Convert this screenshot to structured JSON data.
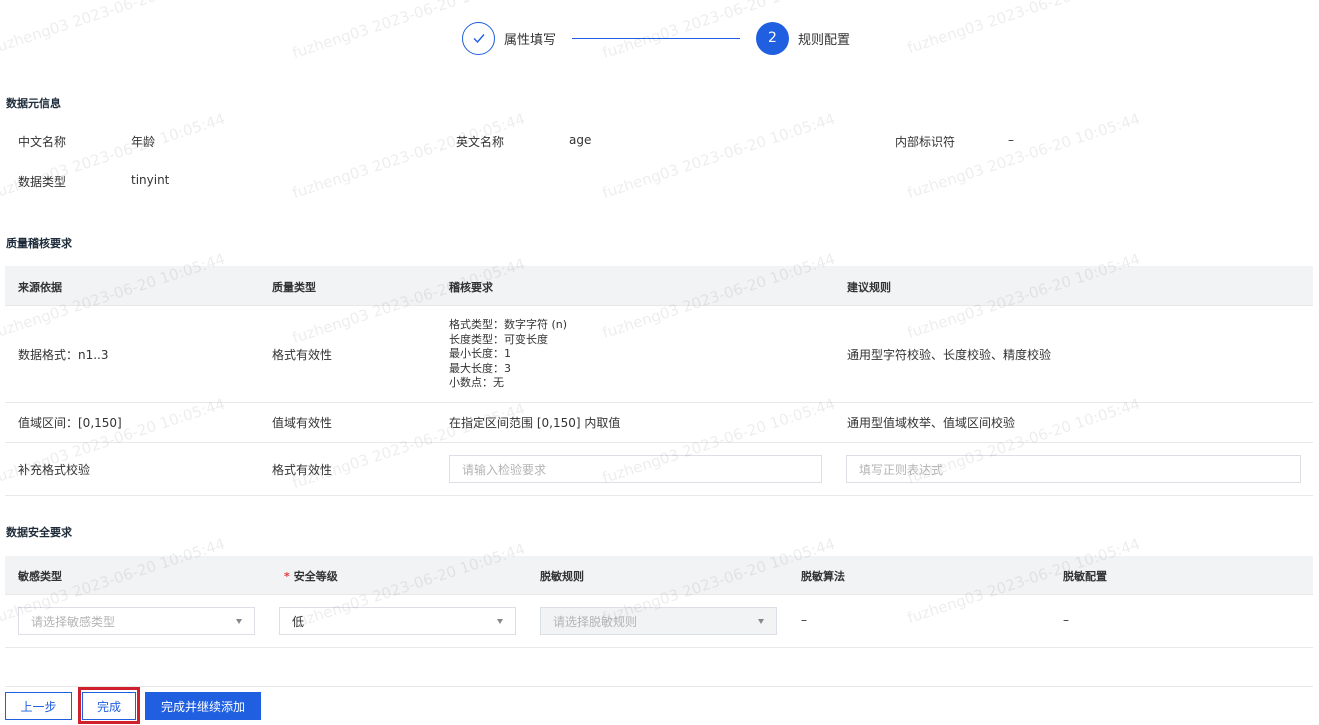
{
  "steps": [
    {
      "label": "属性填写",
      "state": "done",
      "icon": "check-icon"
    },
    {
      "label": "规则配置",
      "state": "active",
      "number": "2"
    }
  ],
  "watermark": "fuzheng03 2023-06-20 10:05:44",
  "metadata": {
    "title": "数据元信息",
    "fields": {
      "cn_name_label": "中文名称",
      "cn_name_value": "年龄",
      "en_name_label": "英文名称",
      "en_name_value": "age",
      "internal_id_label": "内部标识符",
      "internal_id_value": "–",
      "data_type_label": "数据类型",
      "data_type_value": "tinyint"
    }
  },
  "quality": {
    "title": "质量稽核要求",
    "columns": [
      "来源依据",
      "质量类型",
      "稽核要求",
      "建议规则"
    ],
    "rows": [
      {
        "source": "数据格式：n1..3",
        "type": "格式有效性",
        "requirement_lines": [
          "格式类型：数字字符 (n)",
          "长度类型：可变长度",
          "最小长度：1",
          "最大长度：3",
          "小数点：无"
        ],
        "suggested": "通用型字符校验、长度校验、精度校验"
      },
      {
        "source": "值域区间：[0,150]",
        "type": "值域有效性",
        "requirement": "在指定区间范围 [0,150] 内取值",
        "suggested": "通用型值域枚举、值域区间校验"
      },
      {
        "source": "补充格式校验",
        "type": "格式有效性",
        "requirement_placeholder": "请输入检验要求",
        "suggested_placeholder": "填写正则表达式"
      }
    ]
  },
  "security": {
    "title": "数据安全要求",
    "columns": [
      "敏感类型",
      "安全等级",
      "脱敏规则",
      "脱敏算法",
      "脱敏配置"
    ],
    "required_mark": "*",
    "row": {
      "sensitive_type_placeholder": "请选择敏感类型",
      "security_level_value": "低",
      "mask_rule_placeholder": "请选择脱敏规则",
      "mask_algorithm": "–",
      "mask_config": "–"
    }
  },
  "footer": {
    "prev_label": "上一步",
    "finish_label": "完成",
    "finish_continue_label": "完成并继续添加"
  },
  "colors": {
    "primary": "#1f5fe0",
    "highlight": "#d0202e",
    "header_bg": "#f2f3f5"
  }
}
